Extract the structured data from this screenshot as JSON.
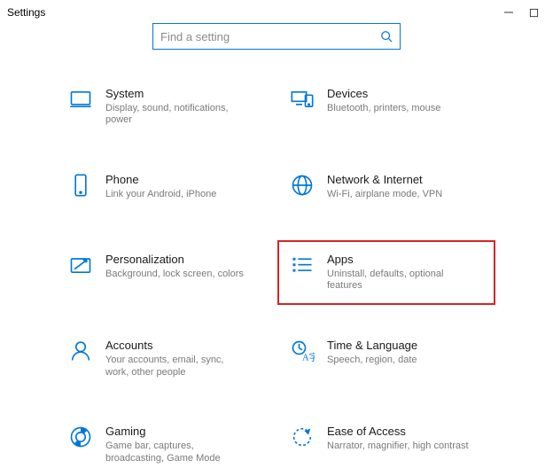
{
  "window": {
    "title": "Settings"
  },
  "search": {
    "placeholder": "Find a setting"
  },
  "items": [
    {
      "label": "System",
      "desc": "Display, sound, notifications, power"
    },
    {
      "label": "Devices",
      "desc": "Bluetooth, printers, mouse"
    },
    {
      "label": "Phone",
      "desc": "Link your Android, iPhone"
    },
    {
      "label": "Network & Internet",
      "desc": "Wi-Fi, airplane mode, VPN"
    },
    {
      "label": "Personalization",
      "desc": "Background, lock screen, colors"
    },
    {
      "label": "Apps",
      "desc": "Uninstall, defaults, optional features"
    },
    {
      "label": "Accounts",
      "desc": "Your accounts, email, sync, work, other people"
    },
    {
      "label": "Time & Language",
      "desc": "Speech, region, date"
    },
    {
      "label": "Gaming",
      "desc": "Game bar, captures, broadcasting, Game Mode"
    },
    {
      "label": "Ease of Access",
      "desc": "Narrator, magnifier, high contrast"
    }
  ],
  "highlight_index": 5
}
